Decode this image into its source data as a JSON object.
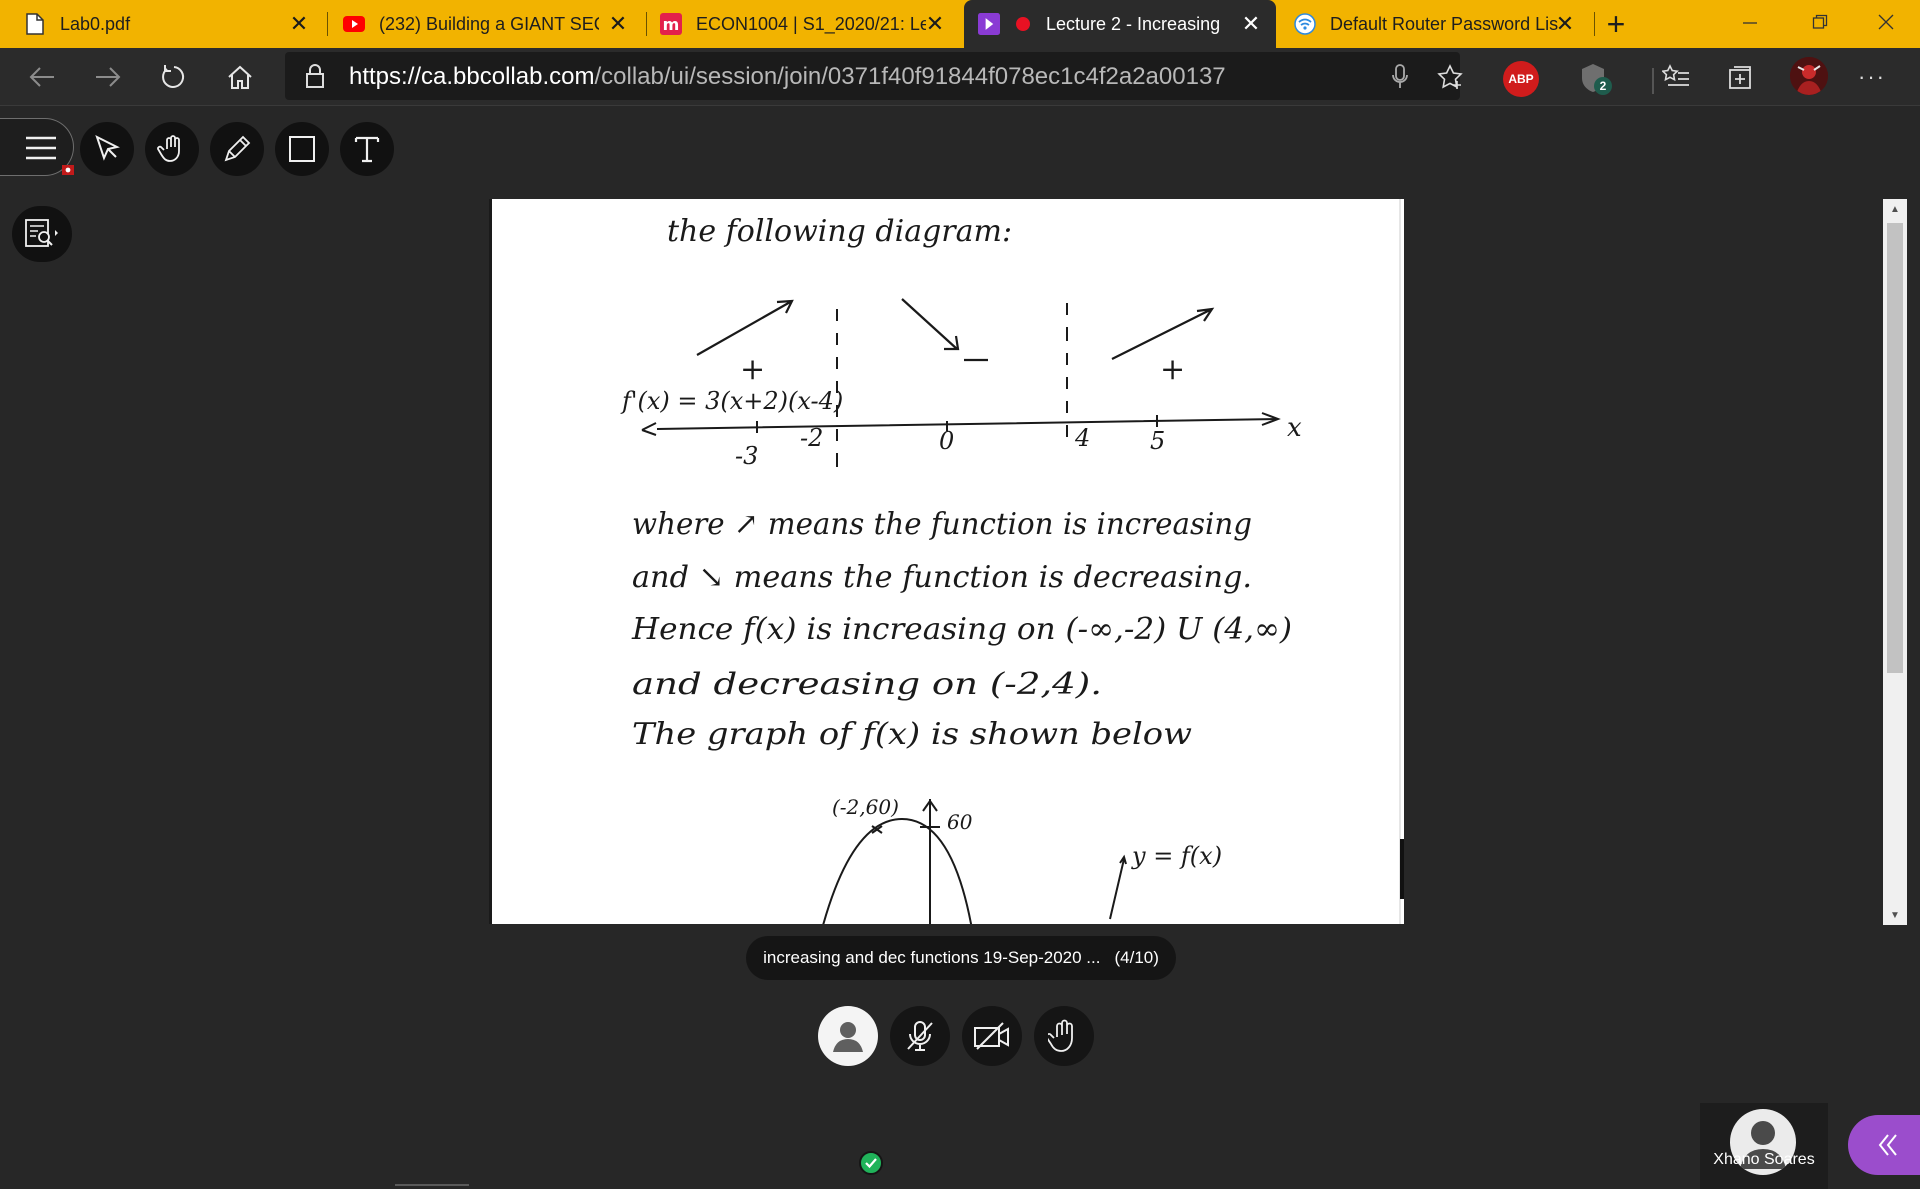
{
  "browser": {
    "tabs": [
      {
        "title": "Lab0.pdf",
        "icon": "pdf-file-icon",
        "active": false
      },
      {
        "title": "(232) Building a GIANT SEC",
        "icon": "youtube-icon",
        "active": false
      },
      {
        "title": "ECON1004 | S1_2020/21: Le",
        "icon": "moodle-icon",
        "active": false
      },
      {
        "title": "Lecture 2 - Increasing",
        "icon": "collaborate-icon",
        "active": true
      },
      {
        "title": "Default Router Password Lis",
        "icon": "wifi-icon",
        "active": false
      }
    ],
    "url": {
      "domain": "https://ca.bbcollab.com",
      "path": "/collab/ui/session/join/0371f40f91844f078ec1c4f2a2a00137"
    },
    "abp_label": "ABP",
    "extension_badge": "2"
  },
  "document": {
    "lines": [
      "the following diagram:",
      "where ↗ means the function is increasing",
      "and ↘ means the function is decreasing.",
      "Hence f(x) is increasing on (-∞,-2) U (4,∞)",
      "and decreasing on (-2,4).",
      "The graph of f(x) is shown below"
    ],
    "number_line": {
      "derivative": "f'(x) = 3(x+2)(x-4)",
      "ticks": [
        "-3",
        "-2",
        "0",
        "4",
        "5"
      ],
      "axis_label": "x",
      "signs": [
        "+",
        "-",
        "+"
      ]
    },
    "graph": {
      "point_label": "(-2,60)",
      "tick_label": "60",
      "curve_label": "y = f(x)"
    },
    "caption": {
      "title": "increasing and dec functions 19-Sep-2020 ...",
      "page": "(4/10)"
    }
  },
  "participant": {
    "name": "Xhano Soares"
  },
  "colors": {
    "tab_bar": "#f2b300",
    "toolbar": "#2b2b2b",
    "app_bg": "#272727",
    "panel_toggle": "#9b4dcc",
    "presence": "#20b35a"
  }
}
